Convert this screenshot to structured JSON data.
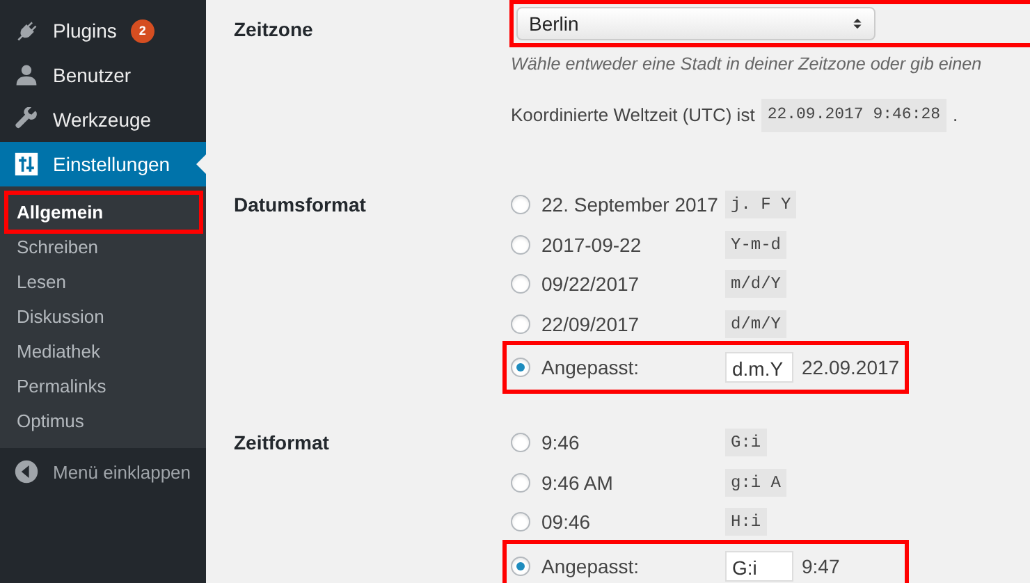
{
  "sidebar": {
    "items": [
      {
        "label": "Plugins",
        "badge": "2",
        "selected": false
      },
      {
        "label": "Benutzer",
        "selected": false
      },
      {
        "label": "Werkzeuge",
        "selected": false
      },
      {
        "label": "Einstellungen",
        "selected": true,
        "submenu": [
          {
            "label": "Allgemein",
            "selected": true,
            "highlighted": true
          },
          {
            "label": "Schreiben",
            "selected": false,
            "highlighted": false
          },
          {
            "label": "Lesen",
            "selected": false,
            "highlighted": false
          },
          {
            "label": "Diskussion",
            "selected": false,
            "highlighted": false
          },
          {
            "label": "Mediathek",
            "selected": false,
            "highlighted": false
          },
          {
            "label": "Permalinks",
            "selected": false,
            "highlighted": false
          },
          {
            "label": "Optimus",
            "selected": false,
            "highlighted": false
          }
        ]
      }
    ],
    "collapse": "Menü einklappen"
  },
  "settings": [
    {
      "kind": "timezone",
      "label": "Zeitzone",
      "select": {
        "value": "Berlin",
        "highlighted": true
      },
      "description": "Wähle entweder eine Stadt in deiner Zeitzone oder gib einen",
      "utc_text": "Koordinierte Weltzeit (UTC) ist",
      "utc_value": "22.09.2017 9:46:28",
      "utc_suffix": "."
    },
    {
      "kind": "radios",
      "label": "Datumsformat",
      "options": [
        {
          "kind": "preset",
          "label": "22. September 2017",
          "code": "j. F Y",
          "selected": false
        },
        {
          "kind": "preset",
          "label": "2017-09-22",
          "code": "Y-m-d",
          "selected": false
        },
        {
          "kind": "preset",
          "label": "09/22/2017",
          "code": "m/d/Y",
          "selected": false
        },
        {
          "kind": "preset",
          "label": "22/09/2017",
          "code": "d/m/Y",
          "selected": false
        },
        {
          "kind": "custom",
          "label": "Angepasst:",
          "value": "d.m.Y",
          "preview": "22.09.2017",
          "selected": true,
          "highlighted": true
        }
      ]
    },
    {
      "kind": "radios",
      "label": "Zeitformat",
      "options": [
        {
          "kind": "preset",
          "label": "9:46",
          "code": "G:i",
          "selected": false
        },
        {
          "kind": "preset",
          "label": "9:46 AM",
          "code": "g:i A",
          "selected": false
        },
        {
          "kind": "preset",
          "label": "09:46",
          "code": "H:i",
          "selected": false
        },
        {
          "kind": "custom",
          "label": "Angepasst:",
          "value": "G:i",
          "preview": "9:47",
          "selected": true,
          "highlighted": true
        }
      ]
    }
  ]
}
